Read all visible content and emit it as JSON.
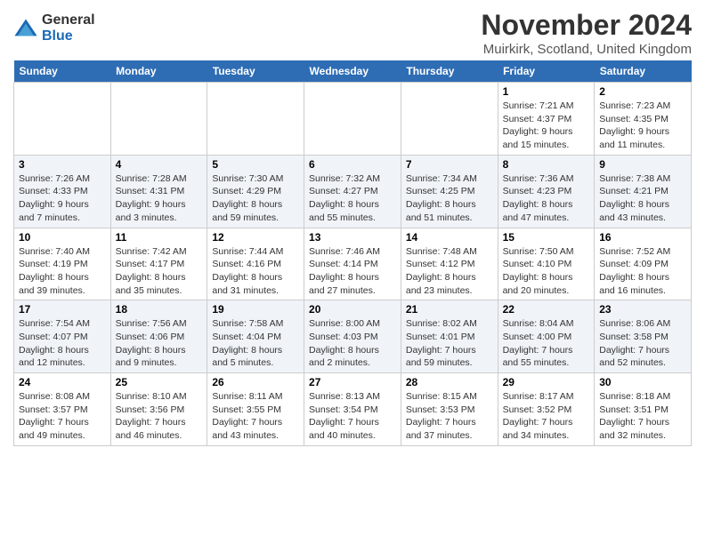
{
  "logo": {
    "general": "General",
    "blue": "Blue"
  },
  "title": "November 2024",
  "subtitle": "Muirkirk, Scotland, United Kingdom",
  "days_header": [
    "Sunday",
    "Monday",
    "Tuesday",
    "Wednesday",
    "Thursday",
    "Friday",
    "Saturday"
  ],
  "weeks": [
    [
      {
        "day": "",
        "info": ""
      },
      {
        "day": "",
        "info": ""
      },
      {
        "day": "",
        "info": ""
      },
      {
        "day": "",
        "info": ""
      },
      {
        "day": "",
        "info": ""
      },
      {
        "day": "1",
        "info": "Sunrise: 7:21 AM\nSunset: 4:37 PM\nDaylight: 9 hours and 15 minutes."
      },
      {
        "day": "2",
        "info": "Sunrise: 7:23 AM\nSunset: 4:35 PM\nDaylight: 9 hours and 11 minutes."
      }
    ],
    [
      {
        "day": "3",
        "info": "Sunrise: 7:26 AM\nSunset: 4:33 PM\nDaylight: 9 hours and 7 minutes."
      },
      {
        "day": "4",
        "info": "Sunrise: 7:28 AM\nSunset: 4:31 PM\nDaylight: 9 hours and 3 minutes."
      },
      {
        "day": "5",
        "info": "Sunrise: 7:30 AM\nSunset: 4:29 PM\nDaylight: 8 hours and 59 minutes."
      },
      {
        "day": "6",
        "info": "Sunrise: 7:32 AM\nSunset: 4:27 PM\nDaylight: 8 hours and 55 minutes."
      },
      {
        "day": "7",
        "info": "Sunrise: 7:34 AM\nSunset: 4:25 PM\nDaylight: 8 hours and 51 minutes."
      },
      {
        "day": "8",
        "info": "Sunrise: 7:36 AM\nSunset: 4:23 PM\nDaylight: 8 hours and 47 minutes."
      },
      {
        "day": "9",
        "info": "Sunrise: 7:38 AM\nSunset: 4:21 PM\nDaylight: 8 hours and 43 minutes."
      }
    ],
    [
      {
        "day": "10",
        "info": "Sunrise: 7:40 AM\nSunset: 4:19 PM\nDaylight: 8 hours and 39 minutes."
      },
      {
        "day": "11",
        "info": "Sunrise: 7:42 AM\nSunset: 4:17 PM\nDaylight: 8 hours and 35 minutes."
      },
      {
        "day": "12",
        "info": "Sunrise: 7:44 AM\nSunset: 4:16 PM\nDaylight: 8 hours and 31 minutes."
      },
      {
        "day": "13",
        "info": "Sunrise: 7:46 AM\nSunset: 4:14 PM\nDaylight: 8 hours and 27 minutes."
      },
      {
        "day": "14",
        "info": "Sunrise: 7:48 AM\nSunset: 4:12 PM\nDaylight: 8 hours and 23 minutes."
      },
      {
        "day": "15",
        "info": "Sunrise: 7:50 AM\nSunset: 4:10 PM\nDaylight: 8 hours and 20 minutes."
      },
      {
        "day": "16",
        "info": "Sunrise: 7:52 AM\nSunset: 4:09 PM\nDaylight: 8 hours and 16 minutes."
      }
    ],
    [
      {
        "day": "17",
        "info": "Sunrise: 7:54 AM\nSunset: 4:07 PM\nDaylight: 8 hours and 12 minutes."
      },
      {
        "day": "18",
        "info": "Sunrise: 7:56 AM\nSunset: 4:06 PM\nDaylight: 8 hours and 9 minutes."
      },
      {
        "day": "19",
        "info": "Sunrise: 7:58 AM\nSunset: 4:04 PM\nDaylight: 8 hours and 5 minutes."
      },
      {
        "day": "20",
        "info": "Sunrise: 8:00 AM\nSunset: 4:03 PM\nDaylight: 8 hours and 2 minutes."
      },
      {
        "day": "21",
        "info": "Sunrise: 8:02 AM\nSunset: 4:01 PM\nDaylight: 7 hours and 59 minutes."
      },
      {
        "day": "22",
        "info": "Sunrise: 8:04 AM\nSunset: 4:00 PM\nDaylight: 7 hours and 55 minutes."
      },
      {
        "day": "23",
        "info": "Sunrise: 8:06 AM\nSunset: 3:58 PM\nDaylight: 7 hours and 52 minutes."
      }
    ],
    [
      {
        "day": "24",
        "info": "Sunrise: 8:08 AM\nSunset: 3:57 PM\nDaylight: 7 hours and 49 minutes."
      },
      {
        "day": "25",
        "info": "Sunrise: 8:10 AM\nSunset: 3:56 PM\nDaylight: 7 hours and 46 minutes."
      },
      {
        "day": "26",
        "info": "Sunrise: 8:11 AM\nSunset: 3:55 PM\nDaylight: 7 hours and 43 minutes."
      },
      {
        "day": "27",
        "info": "Sunrise: 8:13 AM\nSunset: 3:54 PM\nDaylight: 7 hours and 40 minutes."
      },
      {
        "day": "28",
        "info": "Sunrise: 8:15 AM\nSunset: 3:53 PM\nDaylight: 7 hours and 37 minutes."
      },
      {
        "day": "29",
        "info": "Sunrise: 8:17 AM\nSunset: 3:52 PM\nDaylight: 7 hours and 34 minutes."
      },
      {
        "day": "30",
        "info": "Sunrise: 8:18 AM\nSunset: 3:51 PM\nDaylight: 7 hours and 32 minutes."
      }
    ]
  ]
}
